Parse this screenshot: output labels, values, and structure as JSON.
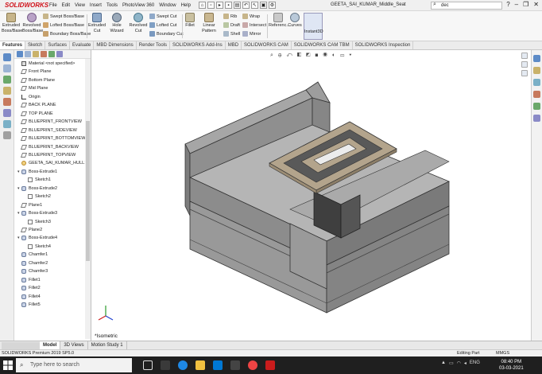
{
  "app": {
    "name": "SOLIDWORKS",
    "document_title": "GEETA_SAI_KUMAR_Middle_Seat",
    "search_value": "dec"
  },
  "menu": [
    "File",
    "Edit",
    "View",
    "Insert",
    "Tools",
    "PhotoView 360",
    "Window",
    "Help"
  ],
  "ribbon": {
    "extruded_boss": "Extruded Boss/Base",
    "revolved_boss": "Revolved Boss/Base",
    "swept_boss": "Swept Boss/Base",
    "lofted_boss": "Lofted Boss/Base",
    "boundary_boss": "Boundary Boss/Base",
    "extruded_cut": "Extruded Cut",
    "hole_wizard": "Hole Wizard",
    "revolved_cut": "Revolved Cut",
    "swept_cut": "Swept Cut",
    "lofted_cut": "Lofted Cut",
    "boundary_cut": "Boundary Cut",
    "fillet": "Fillet",
    "linear_pattern": "Linear Pattern",
    "rib": "Rib",
    "draft": "Draft",
    "shell": "Shell",
    "wrap": "Wrap",
    "intersect": "Intersect",
    "mirror": "Mirror",
    "reference": "Referenc...",
    "curves": "Curves",
    "instant3d": "Instant3D"
  },
  "command_tabs": [
    "Features",
    "Sketch",
    "Surfaces",
    "Evaluate",
    "MBD Dimensions",
    "Render Tools",
    "SOLIDWORKS Add-Ins",
    "MBD",
    "SOLIDWORKS CAM",
    "SOLIDWORKS CAM TBM",
    "SOLIDWORKS Inspection"
  ],
  "tree": [
    {
      "label": "Material <not specified>",
      "icon": "material",
      "indent": 0,
      "caret": ""
    },
    {
      "label": "Front Plane",
      "icon": "plane",
      "indent": 0,
      "caret": ""
    },
    {
      "label": "Bottom Plane",
      "icon": "plane",
      "indent": 0,
      "caret": ""
    },
    {
      "label": "Mid Plane",
      "icon": "plane",
      "indent": 0,
      "caret": ""
    },
    {
      "label": "Origin",
      "icon": "origin",
      "indent": 0,
      "caret": ""
    },
    {
      "label": "BACK PLANE",
      "icon": "plane",
      "indent": 0,
      "caret": ""
    },
    {
      "label": "TOP PLANE",
      "icon": "plane",
      "indent": 0,
      "caret": ""
    },
    {
      "label": "BLUEPRINT_FRONTVIEW",
      "icon": "plane",
      "indent": 0,
      "caret": ""
    },
    {
      "label": "BLUEPRINT_SIDEVIEW",
      "icon": "plane",
      "indent": 0,
      "caret": ""
    },
    {
      "label": "BLUEPRINT_BOTTOMVIEW",
      "icon": "plane",
      "indent": 0,
      "caret": ""
    },
    {
      "label": "BLUEPRINT_BACKVIEW",
      "icon": "plane",
      "indent": 0,
      "caret": ""
    },
    {
      "label": "BLUEPRINT_TOPVIEW",
      "icon": "plane",
      "indent": 0,
      "caret": ""
    },
    {
      "label": "GEETA_SAI_KUMAR_HULL1->?",
      "icon": "part",
      "indent": 0,
      "caret": ""
    },
    {
      "label": "Boss-Extrude1",
      "icon": "boss",
      "indent": 0,
      "caret": "▾"
    },
    {
      "label": "Sketch1",
      "icon": "sketch",
      "indent": 1,
      "caret": ""
    },
    {
      "label": "Boss-Extrude2",
      "icon": "boss",
      "indent": 0,
      "caret": "▾"
    },
    {
      "label": "Sketch2",
      "icon": "sketch",
      "indent": 1,
      "caret": ""
    },
    {
      "label": "Plane1",
      "icon": "plane",
      "indent": 0,
      "caret": ""
    },
    {
      "label": "Boss-Extrude3",
      "icon": "boss",
      "indent": 0,
      "caret": "▾"
    },
    {
      "label": "Sketch3",
      "icon": "sketch",
      "indent": 1,
      "caret": ""
    },
    {
      "label": "Plane2",
      "icon": "plane",
      "indent": 0,
      "caret": ""
    },
    {
      "label": "Boss-Extrude4",
      "icon": "boss",
      "indent": 0,
      "caret": "▾"
    },
    {
      "label": "Sketch4",
      "icon": "sketch",
      "indent": 1,
      "caret": ""
    },
    {
      "label": "Chamfer1",
      "icon": "boss",
      "indent": 0,
      "caret": ""
    },
    {
      "label": "Chamfer2",
      "icon": "boss",
      "indent": 0,
      "caret": ""
    },
    {
      "label": "Chamfer3",
      "icon": "boss",
      "indent": 0,
      "caret": ""
    },
    {
      "label": "Fillet1",
      "icon": "boss",
      "indent": 0,
      "caret": ""
    },
    {
      "label": "Fillet2",
      "icon": "boss",
      "indent": 0,
      "caret": ""
    },
    {
      "label": "Fillet4",
      "icon": "boss",
      "indent": 0,
      "caret": ""
    },
    {
      "label": "Fillet5",
      "icon": "boss",
      "indent": 0,
      "caret": ""
    }
  ],
  "viewport": {
    "view_label": "*Isometric"
  },
  "bottom_tabs": [
    "Model",
    "3D Views",
    "Motion Study 1"
  ],
  "status": {
    "version": "SOLIDWORKS Premium 2019 SP5.0",
    "mode": "Editing Part",
    "units": "MMGS"
  },
  "taskbar": {
    "search_placeholder": "Type here to search",
    "lang": "ENG",
    "time": "08:40 PM",
    "date": "03-03-2021"
  },
  "colors": {
    "brand": "#d0121a",
    "model_body": "#8c8c8c",
    "table_top": "#b3a48c",
    "table_inner": "#595959"
  }
}
